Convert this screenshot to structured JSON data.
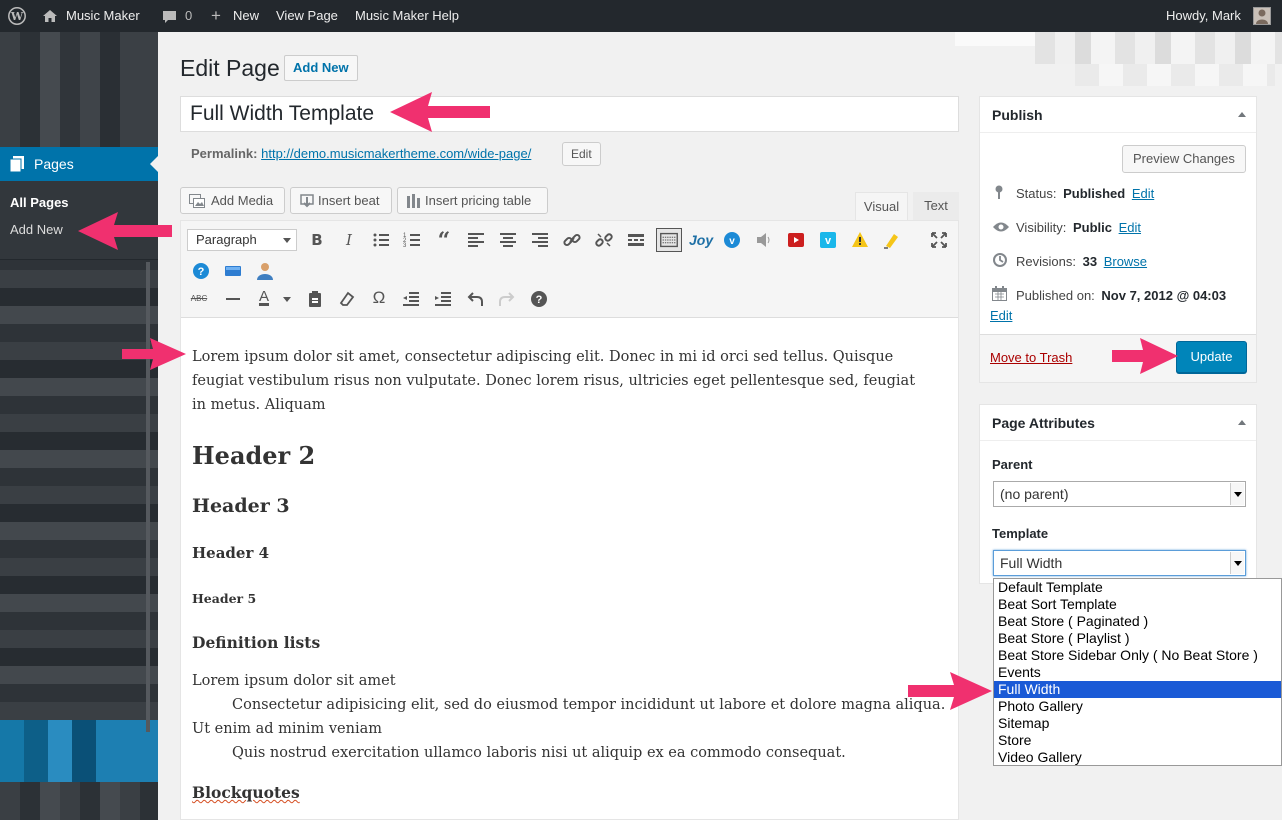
{
  "admin_bar": {
    "site_name": "Music Maker",
    "comments_count": "0",
    "new_label": "New",
    "view_page": "View Page",
    "help": "Music Maker Help",
    "greeting": "Howdy, Mark"
  },
  "sidebar": {
    "menu_label": "Pages",
    "submenu": [
      "All Pages",
      "Add New"
    ]
  },
  "page": {
    "heading": "Edit Page",
    "add_new": "Add New",
    "title_value": "Full Width Template",
    "permalink_label": "Permalink:",
    "permalink_url": "http://demo.musicmakertheme.com/wide-page/",
    "permalink_edit": "Edit"
  },
  "media_buttons": [
    "Add Media",
    "Insert beat",
    "Insert pricing table"
  ],
  "editor_tabs": {
    "visual": "Visual",
    "text": "Text"
  },
  "toolbar": {
    "format_select": "Paragraph"
  },
  "content": {
    "paragraph": "Lorem ipsum dolor sit amet, consectetur adipiscing elit. Donec in mi id orci sed tellus. Quisque feugiat vestibulum risus non vulputate. Donec lorem risus, ultricies eget pellentesque sed, feugiat in metus. Aliquam",
    "h2": "Header 2",
    "h3": "Header 3",
    "h4": "Header 4",
    "h5": "Header 5",
    "deflist_heading": "Definition lists",
    "dt1": "Lorem ipsum dolor sit amet",
    "dd1": "Consectetur adipisicing elit, sed do eiusmod tempor incididunt ut labore et dolore magna aliqua.",
    "dt2": "Ut enim ad minim veniam",
    "dd2": "Quis nostrud exercitation ullamco laboris nisi ut aliquip ex ea commodo consequat.",
    "blockquotes_heading": "Blockquotes"
  },
  "publish_box": {
    "title": "Publish",
    "preview_button": "Preview Changes",
    "status_label": "Status:",
    "status_value": "Published",
    "visibility_label": "Visibility:",
    "visibility_value": "Public",
    "revisions_label": "Revisions:",
    "revisions_value": "33",
    "browse": "Browse",
    "published_on_label": "Published on:",
    "published_on_value": "Nov 7, 2012 @ 04:03",
    "edit": "Edit",
    "trash": "Move to Trash",
    "update": "Update"
  },
  "attributes_box": {
    "title": "Page Attributes",
    "parent_label": "Parent",
    "parent_value": "(no parent)",
    "template_label": "Template",
    "template_value": "Full Width",
    "template_options": [
      "Default Template",
      "Beat Sort Template",
      "Beat Store ( Paginated )",
      "Beat Store ( Playlist )",
      "Beat Store Sidebar Only ( No Beat Store )",
      "Events",
      "Full Width",
      "Photo Gallery",
      "Sitemap",
      "Store",
      "Video Gallery"
    ],
    "selected_option_index": 6
  },
  "colors": {
    "admin_bar": "#23282d",
    "accent": "#0073aa",
    "primary_button": "#0085ba",
    "annotation_arrow": "#f0306f",
    "selected_option": "#1a5ad6"
  }
}
